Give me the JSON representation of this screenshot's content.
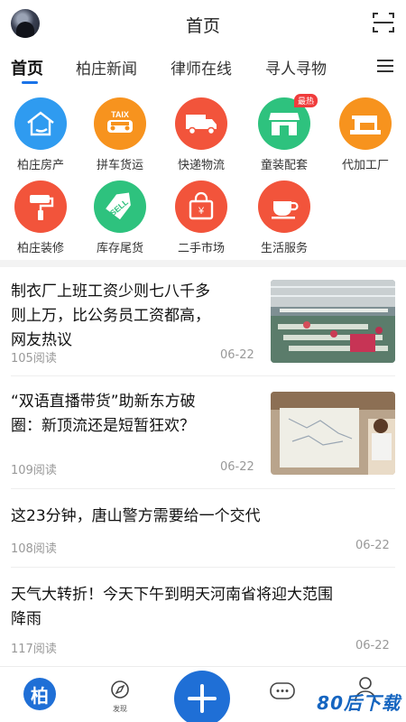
{
  "header": {
    "title": "首页"
  },
  "tabs": [
    {
      "label": "首页"
    },
    {
      "label": "柏庄新闻"
    },
    {
      "label": "律师在线"
    },
    {
      "label": "寻人寻物"
    }
  ],
  "categories": [
    {
      "label": "柏庄房产",
      "icon": "house-icon",
      "color": "#2f9bf0"
    },
    {
      "label": "拼车货运",
      "icon": "taxi-icon",
      "color": "#f7931e",
      "icon_text": "TAIX"
    },
    {
      "label": "快递物流",
      "icon": "truck-icon",
      "color": "#f2543b"
    },
    {
      "label": "童装配套",
      "icon": "shop-icon",
      "color": "#2ec27e",
      "badge": "最热"
    },
    {
      "label": "代加工厂",
      "icon": "sewing-machine-icon",
      "color": "#f7931e"
    },
    {
      "label": "柏庄装修",
      "icon": "paint-roller-icon",
      "color": "#f2543b"
    },
    {
      "label": "库存尾货",
      "icon": "sell-tag-icon",
      "color": "#2ec27e",
      "icon_text": "SELL"
    },
    {
      "label": "二手市场",
      "icon": "shopping-bag-icon",
      "color": "#f2543b",
      "icon_text": "¥"
    },
    {
      "label": "生活服务",
      "icon": "coffee-cup-icon",
      "color": "#f2543b"
    }
  ],
  "news": [
    {
      "title_lines": [
        "制衣厂上班工资少则七八千多",
        "则上万，比公务员工资都高，",
        "网友热议"
      ],
      "reads": "105阅读",
      "date": "06-22"
    },
    {
      "title_lines": [
        "“双语直播带货”助新东方破",
        "圈：新顶流还是短暂狂欢？"
      ],
      "reads": "109阅读",
      "date": "06-22"
    },
    {
      "title_lines": [
        "这23分钟，唐山警方需要给一个交代"
      ],
      "reads": "108阅读",
      "date": "06-22"
    },
    {
      "title_lines": [
        "天气大转折！今天下午到明天河南省将迎大范围",
        "降雨"
      ],
      "reads": "117阅读",
      "date": "06-22"
    }
  ],
  "bottom_nav": {
    "home_label": "柏",
    "discover_label": "发现"
  },
  "watermark": "80后下载",
  "colors": {
    "accent": "#1f6fd6"
  }
}
